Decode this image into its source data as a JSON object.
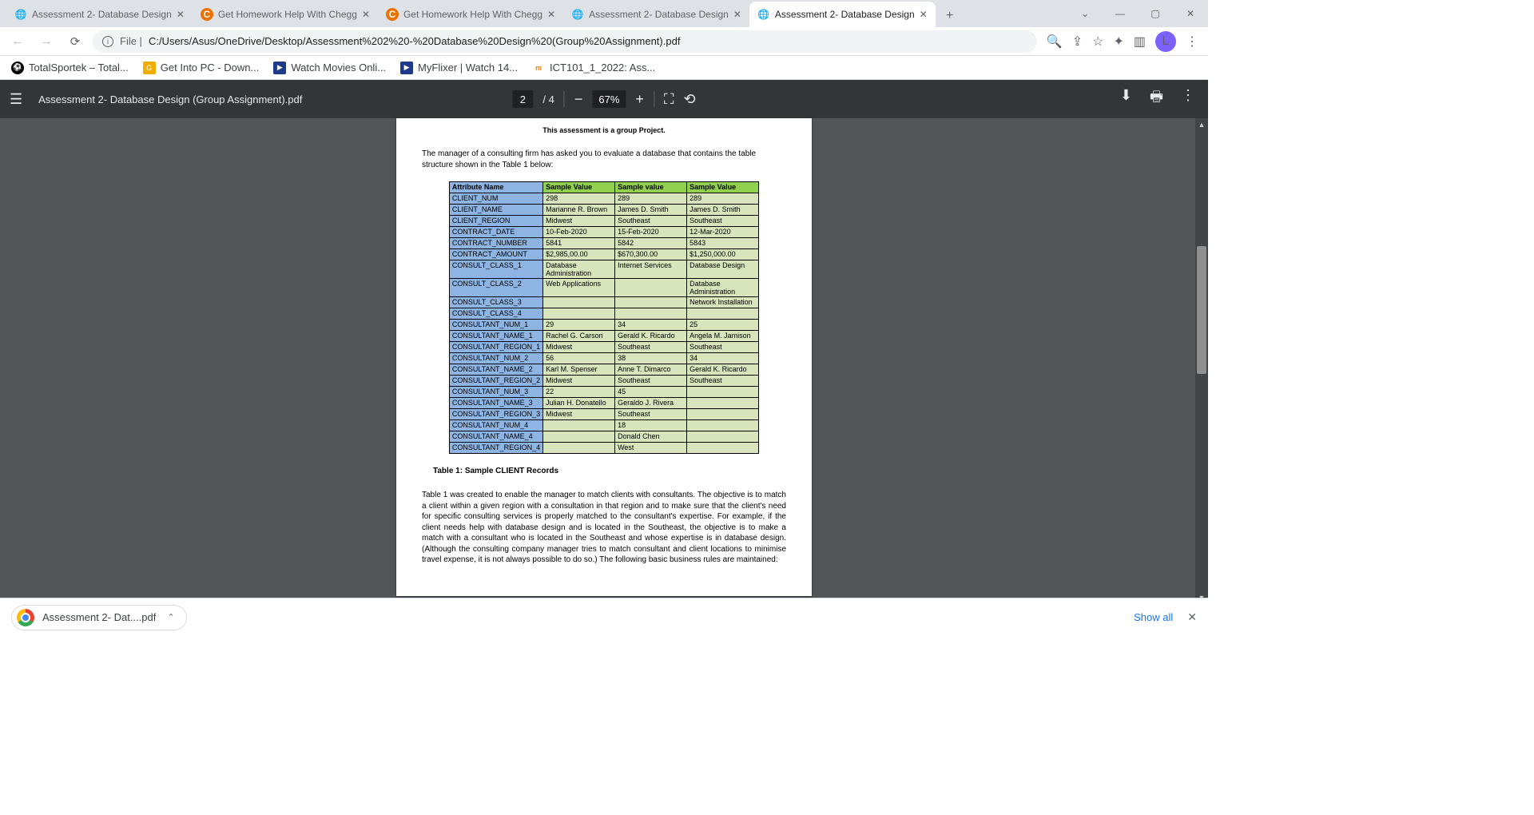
{
  "tabs": {
    "t0": "Assessment 2- Database Design",
    "t1": "Get Homework Help With Chegg",
    "t2": "Get Homework Help With Chegg",
    "t3": "Assessment 2- Database Design",
    "t4": "Assessment 2- Database Design"
  },
  "addr": {
    "prefix": "File |",
    "url": "C:/Users/Asus/OneDrive/Desktop/Assessment%202%20-%20Database%20Design%20(Group%20Assignment).pdf"
  },
  "avatar": "L",
  "bookmarks": {
    "b0": "TotalSportek – Total...",
    "b1": "Get Into PC - Down...",
    "b2": "Watch Movies Onli...",
    "b3": "MyFlixer | Watch 14...",
    "b4": "ICT101_1_2022: Ass..."
  },
  "pdf": {
    "name": "Assessment 2- Database Design (Group Assignment).pdf",
    "page": "2",
    "total": "4",
    "zoom": "67%"
  },
  "doc": {
    "topline": "This assessment is a group Project.",
    "intro": "The manager of a consulting firm has asked you to evaluate a database that contains the table structure shown in the Table 1 below:",
    "headers": {
      "h0": "Attribute Name",
      "h1": "Sample Value",
      "h2": "Sample value",
      "h3": "Sample Value"
    },
    "rows": [
      {
        "a": "CLIENT_NUM",
        "v": [
          "298",
          "289",
          "289"
        ]
      },
      {
        "a": "CLIENT_NAME",
        "v": [
          "Marianne R. Brown",
          "James D. Smith",
          "James D. Smith"
        ]
      },
      {
        "a": "CLIENT_REGION",
        "v": [
          "Midwest",
          "Southeast",
          "Southeast"
        ]
      },
      {
        "a": "CONTRACT_DATE",
        "v": [
          "10-Feb-2020",
          "15-Feb-2020",
          "12-Mar-2020"
        ]
      },
      {
        "a": "CONTRACT_NUMBER",
        "v": [
          "5841",
          "5842",
          "5843"
        ]
      },
      {
        "a": "CONTRACT_AMOUNT",
        "v": [
          "$2,985,00.00",
          "$670,300.00",
          "$1,250,000.00"
        ]
      },
      {
        "a": "CONSULT_CLASS_1",
        "v": [
          "Database Administration",
          "Internet Services",
          "Database Design"
        ]
      },
      {
        "a": "CONSULT_CLASS_2",
        "v": [
          "Web Applications",
          "",
          "Database Administration"
        ]
      },
      {
        "a": "CONSULT_CLASS_3",
        "v": [
          "",
          "",
          "Network Installation"
        ]
      },
      {
        "a": "CONSULT_CLASS_4",
        "v": [
          "",
          "",
          ""
        ]
      },
      {
        "a": "CONSULTANT_NUM_1",
        "v": [
          "29",
          "34",
          "25"
        ]
      },
      {
        "a": "CONSULTANT_NAME_1",
        "v": [
          "Rachel G. Carson",
          "Gerald K. Ricardo",
          "Angela M. Jamison"
        ]
      },
      {
        "a": "CONSULTANT_REGION_1",
        "v": [
          "Midwest",
          "Southeast",
          "Southeast"
        ]
      },
      {
        "a": "CONSULTANT_NUM_2",
        "v": [
          "56",
          "38",
          "34"
        ]
      },
      {
        "a": "CONSULTANT_NAME_2",
        "v": [
          "Karl M. Spenser",
          "Anne T. Dimarco",
          "Gerald K. Ricardo"
        ]
      },
      {
        "a": "CONSULTANT_REGION_2",
        "v": [
          "Midwest",
          "Southeast",
          "Southeast"
        ]
      },
      {
        "a": "CONSULTANT_NUM_3",
        "v": [
          "22",
          "45",
          ""
        ]
      },
      {
        "a": "CONSULTANT_NAME_3",
        "v": [
          "Julian H. Donatello",
          "Geraldo J. Rivera",
          ""
        ]
      },
      {
        "a": "CONSULTANT_REGION_3",
        "v": [
          "Midwest",
          "Southeast",
          ""
        ]
      },
      {
        "a": "CONSULTANT_NUM_4",
        "v": [
          "",
          "18",
          ""
        ]
      },
      {
        "a": "CONSULTANT_NAME_4",
        "v": [
          "",
          "Donald Chen",
          ""
        ]
      },
      {
        "a": "CONSULTANT_REGION_4",
        "v": [
          "",
          "West",
          ""
        ]
      }
    ],
    "caption": "Table 1: Sample CLIENT Records",
    "para": "Table 1 was created to enable the manager to match clients with consultants. The objective is to match a client within a given region with a consultation in that region and to make sure that the client's need for specific consulting services is properly matched to the consultant's expertise. For example, if the client needs help with database design and is located in the Southeast, the objective is to make a match with a consultant who is located in the Southeast and whose expertise is in database design. (Although the consulting company manager tries to match consultant and client locations to minimise travel expense, it is not always possible to do so.) The following basic business rules are maintained:"
  },
  "download": {
    "file": "Assessment 2- Dat....pdf",
    "showall": "Show all"
  }
}
